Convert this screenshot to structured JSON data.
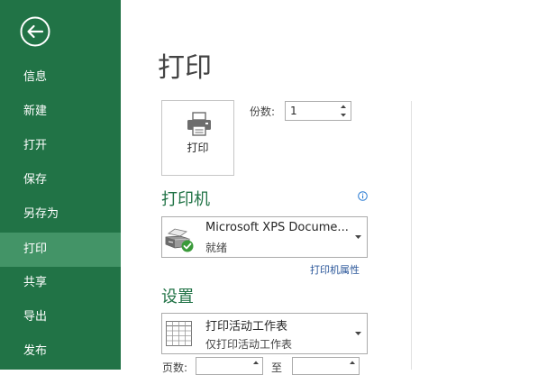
{
  "sidebar": {
    "items": [
      {
        "label": "信息"
      },
      {
        "label": "新建"
      },
      {
        "label": "打开"
      },
      {
        "label": "保存"
      },
      {
        "label": "另存为"
      },
      {
        "label": "打印"
      },
      {
        "label": "共享"
      },
      {
        "label": "导出"
      },
      {
        "label": "发布"
      }
    ],
    "active_index": 5
  },
  "main": {
    "title": "打印",
    "print_button_label": "打印",
    "copies_label": "份数:",
    "copies_value": "1",
    "printer": {
      "heading": "打印机",
      "name": "Microsoft XPS Docume...",
      "status": "就绪",
      "properties_link": "打印机属性"
    },
    "settings": {
      "heading": "设置",
      "scope_title": "打印活动工作表",
      "scope_subtitle": "仅打印活动工作表",
      "pages_label": "页数:",
      "to_label": "至"
    }
  },
  "colors": {
    "sidebar_bg": "#217346",
    "sidebar_active": "#439467",
    "heading_green": "#217346",
    "link_blue": "#2b579a"
  }
}
